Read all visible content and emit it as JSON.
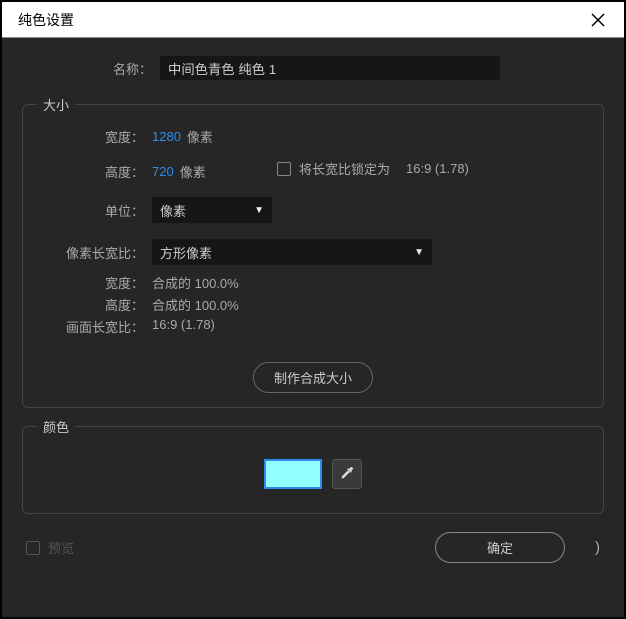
{
  "dialog": {
    "title": "纯色设置",
    "name_label": "名称：",
    "name_value": "中间色青色 纯色 1"
  },
  "size": {
    "group_title": "大小",
    "width_label": "宽度：",
    "width_value": "1280",
    "width_unit": "像素",
    "height_label": "高度：",
    "height_value": "720",
    "height_unit": "像素",
    "unit_label": "单位：",
    "unit_value": "像素",
    "par_label": "像素长宽比：",
    "par_value": "方形像素",
    "lock_aspect_label": "将长宽比锁定为",
    "lock_aspect_ratio": "16:9 (1.78)",
    "info_width_label": "宽度：",
    "info_width_value": "合成的 100.0%",
    "info_height_label": "高度：",
    "info_height_value": "合成的 100.0%",
    "frame_aspect_label": "画面长宽比：",
    "frame_aspect_value": "16:9 (1.78)",
    "make_comp_size": "制作合成大小"
  },
  "color": {
    "group_title": "颜色",
    "swatch_hex": "#91fffe"
  },
  "footer": {
    "preview_label": "预览",
    "ok_label": "确定",
    "close_paren": ")"
  }
}
